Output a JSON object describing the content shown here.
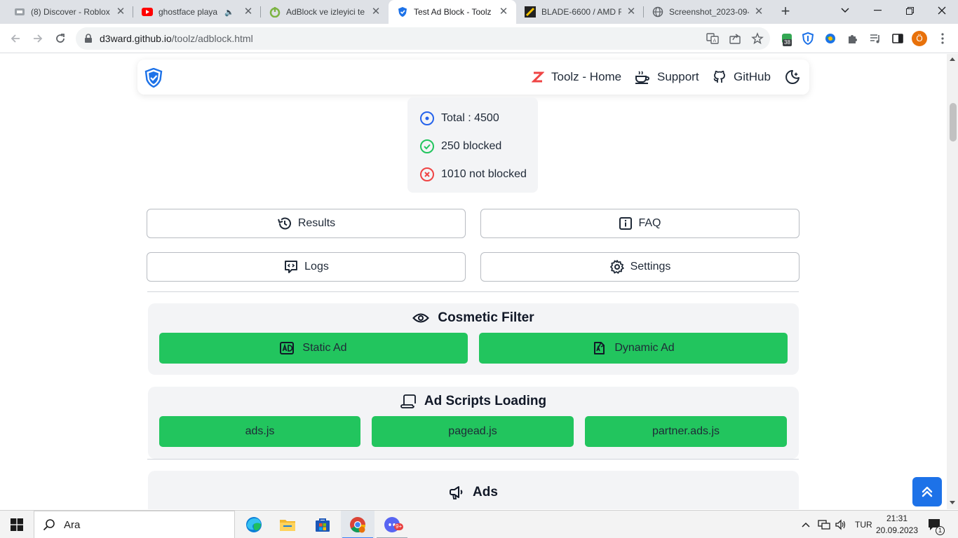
{
  "browser": {
    "tabs": [
      {
        "title": "(8) Discover - Roblox",
        "icon": "roblox-favicon"
      },
      {
        "title": "ghostface playa -",
        "icon": "youtube-favicon",
        "audio": true
      },
      {
        "title": "AdBlock ve izleyici te",
        "icon": "power-favicon"
      },
      {
        "title": "Test Ad Block - Toolz",
        "icon": "shield-favicon",
        "active": true
      },
      {
        "title": "BLADE-6600 / AMD R",
        "icon": "blade-favicon"
      },
      {
        "title": "Screenshot_2023-09-",
        "icon": "globe-favicon"
      }
    ],
    "address": {
      "host": "d3ward.github.io",
      "path": "/toolz/adblock.html"
    },
    "extension_badge": "38",
    "profile_initial": "Ö"
  },
  "nav": {
    "home_label": "Toolz - Home",
    "support_label": "Support",
    "github_label": "GitHub"
  },
  "stats": {
    "total": "Total : 4500",
    "blocked": "250 blocked",
    "not_blocked": "1010 not blocked"
  },
  "actions": {
    "results": "Results",
    "faq": "FAQ",
    "logs": "Logs",
    "settings": "Settings"
  },
  "cosmetic": {
    "title": "Cosmetic Filter",
    "static_ad": "Static Ad",
    "dynamic_ad": "Dynamic Ad"
  },
  "scripts": {
    "title": "Ad Scripts Loading",
    "items": [
      "ads.js",
      "pagead.js",
      "partner.ads.js"
    ]
  },
  "ads": {
    "title": "Ads"
  },
  "colors": {
    "green": "#22c55e",
    "blue": "#1d72e8",
    "total_icon": "#2563eb",
    "blocked_icon": "#22c55e",
    "not_blocked_icon": "#ef4444"
  },
  "taskbar": {
    "search_placeholder": "Ara",
    "language": "TUR",
    "time": "21:31",
    "date": "20.09.2023",
    "notifications": "1",
    "discord_badge": "9+"
  }
}
